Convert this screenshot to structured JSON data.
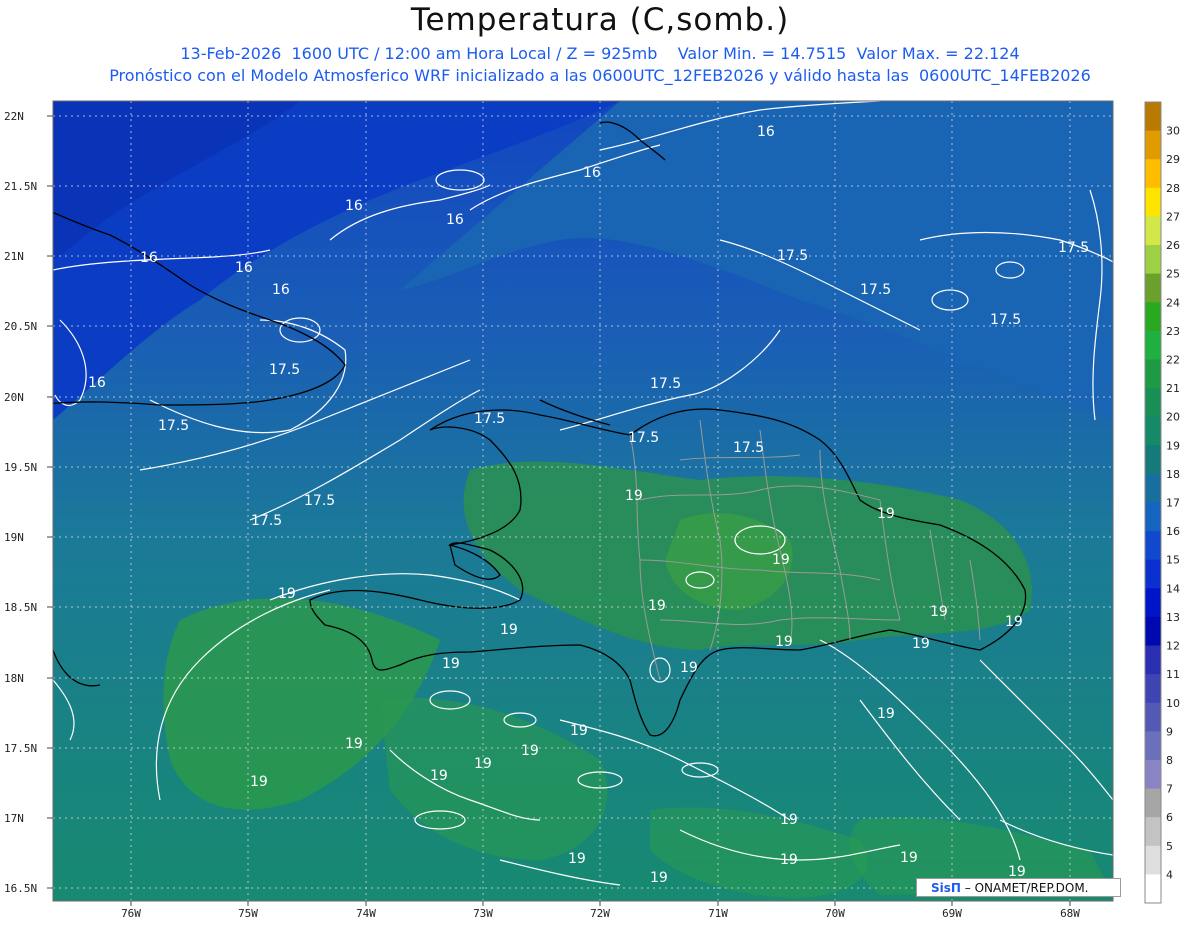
{
  "header": {
    "title": "Temperatura (C,somb.)",
    "subtitle_1": "13-Feb-2026  1600 UTC / 12:00 am Hora Local / Z = 925mb    Valor Min. = 14.7515  Valor Max. = 22.124",
    "subtitle_2": "Pronóstico con el Modelo Atmosferico WRF inicializado a las 0600UTC_12FEB2026 y válido hasta las  0600UTC_14FEB2026"
  },
  "map": {
    "lat_labels": [
      "22N",
      "21.5N",
      "21N",
      "20.5N",
      "20N",
      "19.5N",
      "19N",
      "18.5N",
      "18N",
      "17.5N",
      "17N",
      "16.5N"
    ],
    "lon_labels": [
      "76W",
      "75W",
      "74W",
      "73W",
      "72W",
      "71W",
      "70W",
      "69W",
      "68W"
    ],
    "contour_labels": [
      "16",
      "17.5",
      "19"
    ],
    "colors": {
      "cold": "#0a3fc0",
      "mid": "#1a6ab0",
      "warm": "#178a72",
      "green": "#2f9a4a",
      "contour": "#ffffff",
      "coast": "#000000",
      "provinces": "#9a9a9a"
    }
  },
  "colorbar": {
    "ticks": [
      "30",
      "29",
      "28",
      "27",
      "26",
      "25",
      "24",
      "23",
      "22",
      "21",
      "20",
      "19",
      "18",
      "17",
      "16",
      "15",
      "14",
      "13",
      "12",
      "11",
      "10",
      "9",
      "8",
      "7",
      "6",
      "5",
      "4"
    ],
    "colors": [
      "#b87a00",
      "#e09b00",
      "#ffbd00",
      "#ffe400",
      "#d2e84a",
      "#9ed043",
      "#6aa12c",
      "#2aa820",
      "#20b040",
      "#1e9a44",
      "#1a8f55",
      "#168a68",
      "#177a7a",
      "#186e9e",
      "#1565c0",
      "#1049cd",
      "#0c2fd0",
      "#0014c8",
      "#0008b0",
      "#2a2eb0",
      "#3f44b3",
      "#5459b3",
      "#6b70ba",
      "#8a84c4",
      "#a6a6a6",
      "#c3c3c3",
      "#dedede",
      "#ffffff"
    ]
  },
  "credit": {
    "brand": "SisΠ",
    "text": "– ONAMET/REP.DOM."
  }
}
